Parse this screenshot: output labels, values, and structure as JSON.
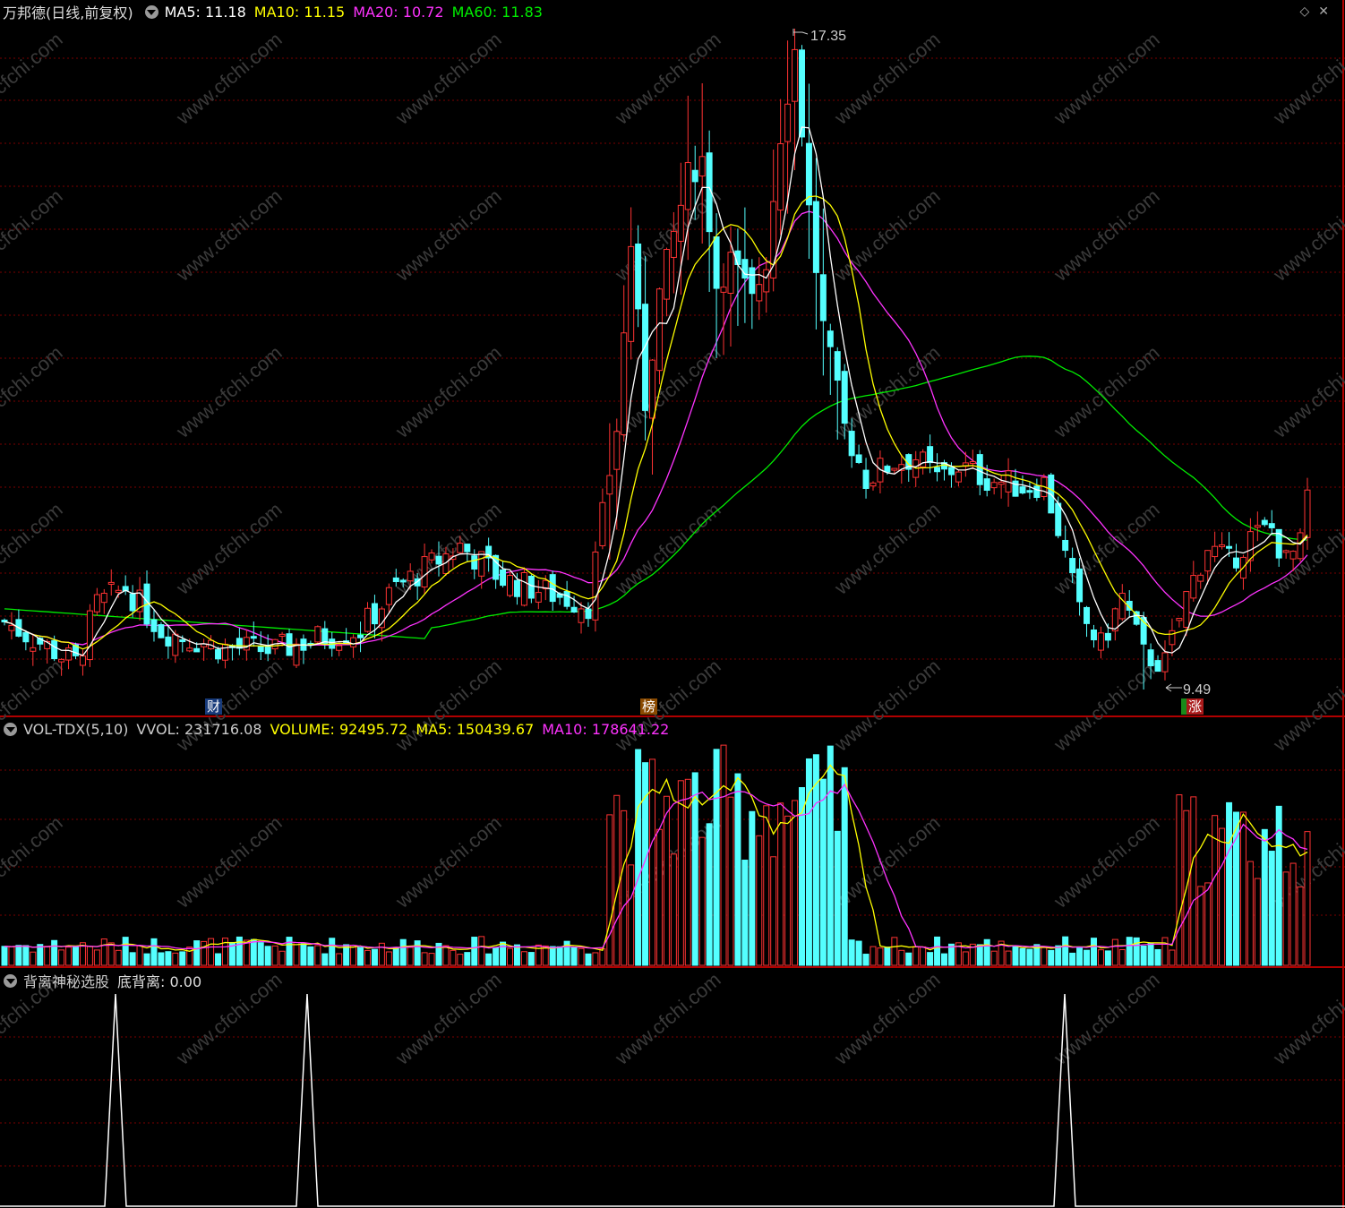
{
  "colors": {
    "up": "#ff3333",
    "down": "#54ffff",
    "ma5": "#ffffff",
    "ma10": "#ffff00",
    "ma20": "#ff33ff",
    "ma60": "#00ee00",
    "grid": "#7a0000",
    "text": "#cccccc"
  },
  "main_panel": {
    "stock_name": "万邦德(日线,前复权)",
    "ma5": "MA5: 11.18",
    "ma10": "MA10: 11.15",
    "ma20": "MA20: 10.72",
    "ma60": "MA60: 11.83",
    "high_label": "17.35",
    "low_label": "9.49",
    "event_tags": [
      "财",
      "榜",
      "涨"
    ],
    "icons": [
      "diamond-icon",
      "close-icon"
    ]
  },
  "volume_panel": {
    "name": "VOL-TDX(5,10)",
    "vvol": "VVOL: 231716.08",
    "volume": "VOLUME: 92495.72",
    "ma5": "MA5: 150439.67",
    "ma10": "MA10: 178641.22"
  },
  "indicator_panel": {
    "name": "背离神秘选股",
    "signal_label": "底背离: 0.00"
  },
  "watermark": "www.cfchi.com",
  "chart_data": {
    "type": "candlestick",
    "price_range": [
      9.49,
      17.35
    ],
    "high": 17.35,
    "low": 9.49,
    "last_close": 11.18,
    "ma_last": {
      "MA5": 11.18,
      "MA10": 11.15,
      "MA20": 10.72,
      "MA60": 11.83
    },
    "volume_last": {
      "VVOL": 231716.08,
      "VOLUME": 92495.72,
      "MA5": 150439.67,
      "MA10": 178641.22
    },
    "divergence_signal_last": 0.0,
    "divergence_spikes": 3
  }
}
